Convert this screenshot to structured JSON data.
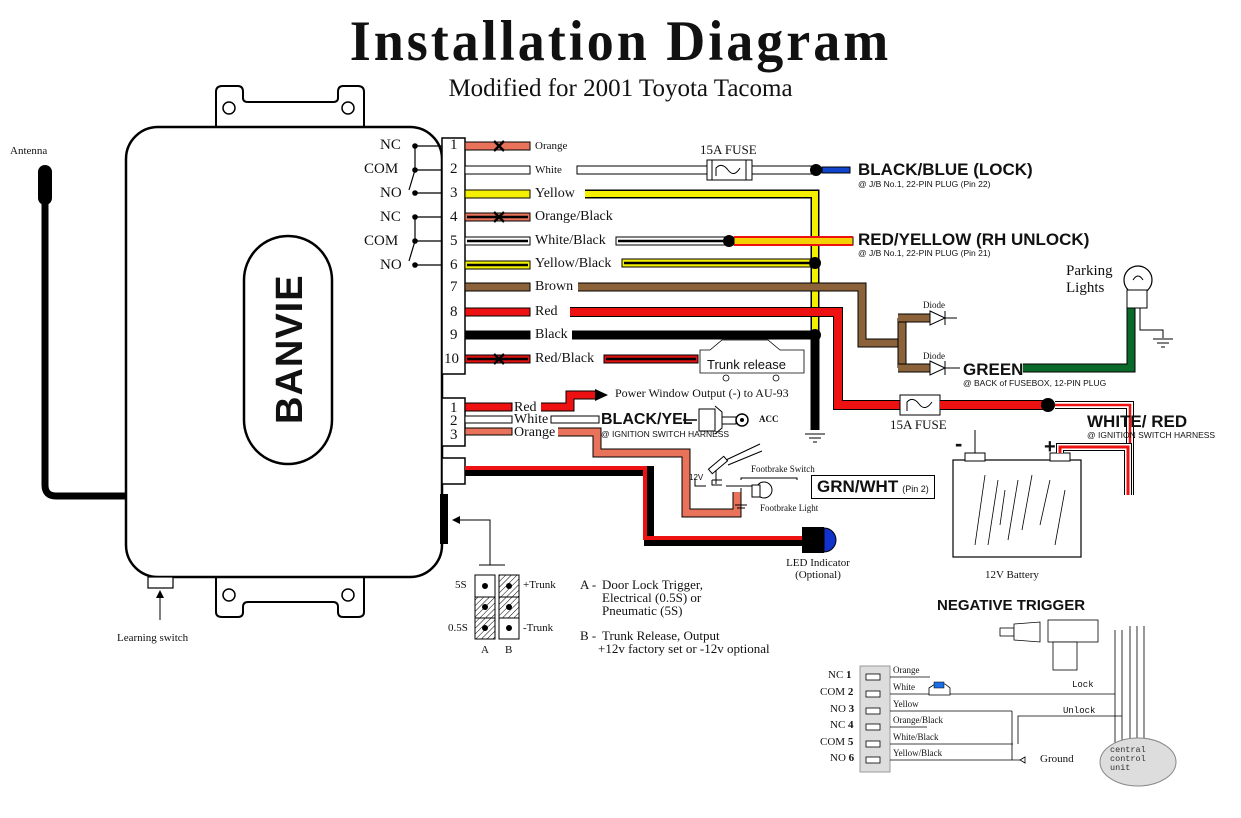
{
  "header": {
    "title": "Installation Diagram",
    "subtitle": "Modified for 2001 Toyota Tacoma"
  },
  "module": {
    "brand": "BANVIE",
    "antenna_label": "Antenna",
    "learning_switch_label": "Learning switch"
  },
  "relay_labels": [
    "NC",
    "COM",
    "NO",
    "NC",
    "COM",
    "NO"
  ],
  "main_connector": {
    "pins": [
      {
        "pin": "1",
        "wire": "Orange",
        "color": "#e8735a",
        "cut": true
      },
      {
        "pin": "2",
        "wire": "White",
        "color": "#ffffff",
        "cut": false
      },
      {
        "pin": "3",
        "wire": "Yellow",
        "color": "#f5f000",
        "cut": false
      },
      {
        "pin": "4",
        "wire": "Orange/Black",
        "color": "#e8735a",
        "cut": true
      },
      {
        "pin": "5",
        "wire": "White/Black",
        "color": "#ffffff",
        "cut": false
      },
      {
        "pin": "6",
        "wire": "Yellow/Black",
        "color": "#f5f000",
        "cut": false
      },
      {
        "pin": "7",
        "wire": "Brown",
        "color": "#8b6239",
        "cut": false
      },
      {
        "pin": "8",
        "wire": "Red",
        "color": "#ee1111",
        "cut": false
      },
      {
        "pin": "9",
        "wire": "Black",
        "color": "#000000",
        "cut": false
      },
      {
        "pin": "10",
        "wire": "Red/Black",
        "color": "#dd1111",
        "cut": true
      }
    ]
  },
  "small_connector": {
    "pins": [
      {
        "pin": "1",
        "wire": "Red"
      },
      {
        "pin": "2",
        "wire": "White"
      },
      {
        "pin": "3",
        "wire": "Orange"
      }
    ]
  },
  "connections": {
    "lock": {
      "label": "BLACK/BLUE (LOCK)",
      "note": "@ J/B No.1, 22-PIN PLUG (Pin 22)",
      "fuse": "15A FUSE"
    },
    "unlock": {
      "label": "RED/YELLOW (RH UNLOCK)",
      "note": "@ J/B No.1, 22-PIN PLUG (Pin 21)"
    },
    "parking": {
      "label": "Parking Lights",
      "diode1": "Diode",
      "diode2": "Diode",
      "wire": "GREEN",
      "note": "@ BACK of FUSEBOX, 12-PIN PLUG"
    },
    "power": {
      "label": "WHITE/ RED",
      "note": "@ IGNITION SWITCH HARNESS",
      "fuse": "15A FUSE"
    },
    "trunk": {
      "label": "Trunk release"
    },
    "power_window": {
      "label": "Power Window Output (-) to AU-93"
    },
    "acc": {
      "label": "BLACK/YEL",
      "note": "@ IGNITION SWITCH HARNESS",
      "key": "ACC"
    },
    "footbrake": {
      "switch": "Footbrake Switch",
      "light": "Footbrake Light",
      "v12": "12V",
      "wire": "GRN/WHT",
      "pin": "(Pin 2)"
    },
    "led": {
      "label": "LED Indicator",
      "sub": "(Optional)"
    },
    "battery": {
      "label": "12V Battery",
      "neg": "-",
      "pos": "+"
    }
  },
  "jumpers": {
    "row_labels": [
      "5S",
      "0.5S"
    ],
    "right_labels": [
      "+Trunk",
      "-Trunk"
    ],
    "cols": [
      "A",
      "B"
    ],
    "notes": [
      {
        "key": "A -",
        "lines": [
          "Door Lock Trigger,",
          "Electrical (0.5S) or",
          "Pneumatic (5S)"
        ]
      },
      {
        "key": "B -",
        "lines": [
          "Trunk Release, Output",
          "+12v factory set or -12v optional"
        ]
      }
    ]
  },
  "negative_trigger": {
    "title": "NEGATIVE TRIGGER",
    "rows": [
      {
        "type": "NC",
        "pin": "1",
        "wire": "Orange"
      },
      {
        "type": "COM",
        "pin": "2",
        "wire": "White"
      },
      {
        "type": "NO",
        "pin": "3",
        "wire": "Yellow"
      },
      {
        "type": "NC",
        "pin": "4",
        "wire": "Orange/Black"
      },
      {
        "type": "COM",
        "pin": "5",
        "wire": "White/Black"
      },
      {
        "type": "NO",
        "pin": "6",
        "wire": "Yellow/Black"
      }
    ],
    "lock": "Lock",
    "unlock": "Unlock",
    "ground": "Ground",
    "ccu": [
      "central",
      "control",
      "unit"
    ]
  }
}
